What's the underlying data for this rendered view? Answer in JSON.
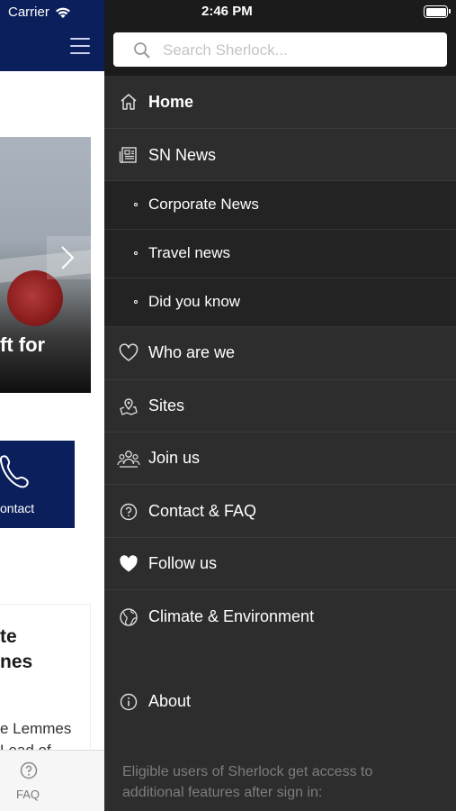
{
  "status_bar": {
    "carrier": "Carrier",
    "time": "2:46 PM"
  },
  "background_page": {
    "hero_caption": "ft for",
    "contact_tile_label": "ontact",
    "card_title": "te\nnes",
    "card_body": "e Lemmes\nLead of",
    "tab_faq_label": "FAQ"
  },
  "drawer": {
    "search": {
      "placeholder": "Search Sherlock..."
    },
    "items": [
      {
        "label": "Home",
        "icon": "home-icon"
      },
      {
        "label": "SN News",
        "icon": "newspaper-icon"
      },
      {
        "label": "Corporate News"
      },
      {
        "label": "Travel news"
      },
      {
        "label": "Did you know"
      },
      {
        "label": "Who are we",
        "icon": "heart-outline-icon"
      },
      {
        "label": "Sites",
        "icon": "map-pin-icon"
      },
      {
        "label": "Join us",
        "icon": "people-icon"
      },
      {
        "label": "Contact & FAQ",
        "icon": "question-circle-icon"
      },
      {
        "label": "Follow us",
        "icon": "heart-filled-icon"
      },
      {
        "label": "Climate & Environment",
        "icon": "globe-icon"
      },
      {
        "label": "About",
        "icon": "info-circle-icon"
      }
    ],
    "footnote": "Eligible users of Sherlock get access to additional features after sign in:"
  },
  "colors": {
    "navy": "#0b1f5c",
    "drawer_bg": "#2d2d2d",
    "drawer_dark": "#1b1b1b",
    "subitem_bg": "#232323"
  }
}
